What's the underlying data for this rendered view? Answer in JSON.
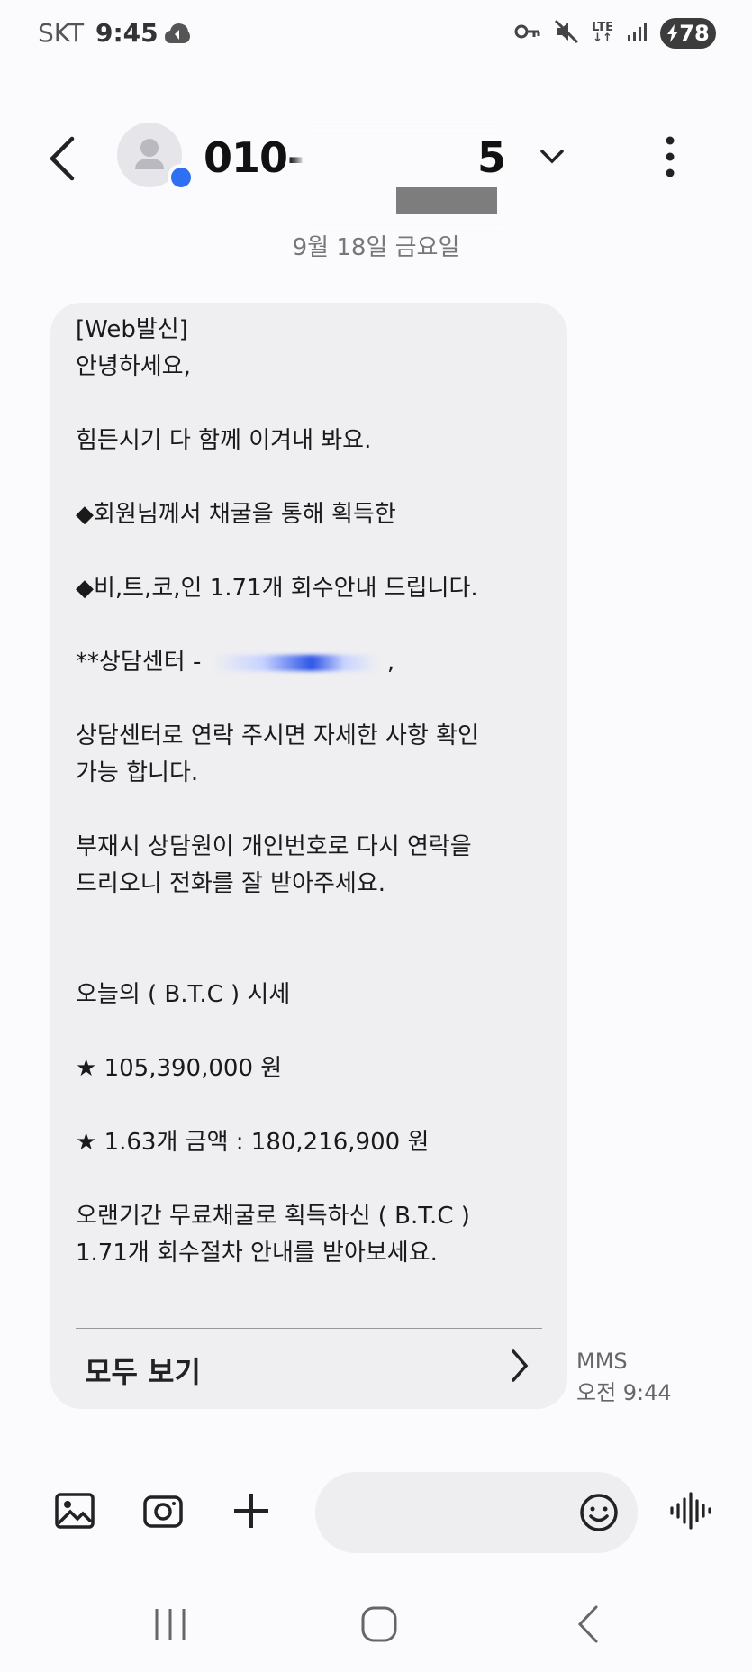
{
  "status_bar": {
    "carrier": "SKT",
    "time": "9:45",
    "network": "LTE",
    "battery": "78"
  },
  "header": {
    "contact_prefix": "010-",
    "contact_suffix": "5"
  },
  "date_label": "9월 18일 금요일",
  "message": {
    "line1": "[Web발신]\n안녕하세요,\n\n힘든시기 다 함께 이겨내 봐요.\n\n◆회원님께서 채굴을 통해 획득한\n\n◆비,트,코,인 1.71개 회수안내 드립니다.\n\n",
    "line2_prefix": "**상담센터 - ",
    "line2_suffix": " ,",
    "line3": "\n\n상담센터로 연락 주시면 자세한 사항 확인\n가능 합니다.\n\n 부재시 상담원이 개인번호로 다시 연락을\n드리오니 전화를 잘 받아주세요.\n\n\n오늘의 ( B.T.C ) 시세\n\n★ 105,390,000 원\n\n★ 1.63개 금액 :  180,216,900 원\n\n오랜기간 무료채굴로 획득하신 ( B.T.C )\n1.71개 회수절차 안내를 받아보세요.",
    "view_all": "모두 보기"
  },
  "meta": {
    "type": "MMS",
    "time": "오전 9:44"
  },
  "colors": {
    "background": "#fbfbfd",
    "bubble": "#efeff2",
    "accent": "#2f6ff1"
  }
}
